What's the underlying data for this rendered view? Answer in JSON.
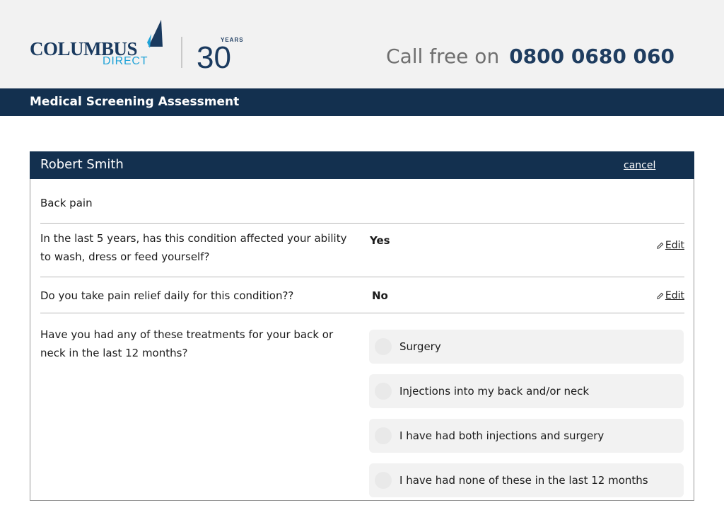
{
  "header": {
    "logo_text": "COLUMBUS",
    "logo_sub": "DIRECT",
    "logo_years_label": "YEARS",
    "logo_years_number": "30",
    "call_label": "Call free on",
    "call_number": "0800 0680 060"
  },
  "band": {
    "title": "Medical Screening Assessment"
  },
  "card": {
    "name": "Robert Smith",
    "cancel_label": "cancel",
    "condition": "Back pain",
    "questions": [
      {
        "text": "In the last 5 years, has this condition affected your ability to wash, dress or feed yourself?",
        "answer": "Yes",
        "edit_label": "Edit"
      },
      {
        "text": "Do you take pain relief daily for this condition??",
        "answer": "No",
        "edit_label": "Edit"
      }
    ],
    "treatment_question": "Have you had any of these treatments for your back or neck in the last 12 months?",
    "treatment_options": [
      "Surgery",
      "Injections into my back and/or neck",
      "I have had both injections and surgery",
      "I have had none of these in the last 12 months"
    ]
  },
  "colors": {
    "navy": "#13304f",
    "brand_blue": "#20a3d8",
    "header_bg": "#f2f2f2",
    "option_bg": "#f2f2f2"
  }
}
